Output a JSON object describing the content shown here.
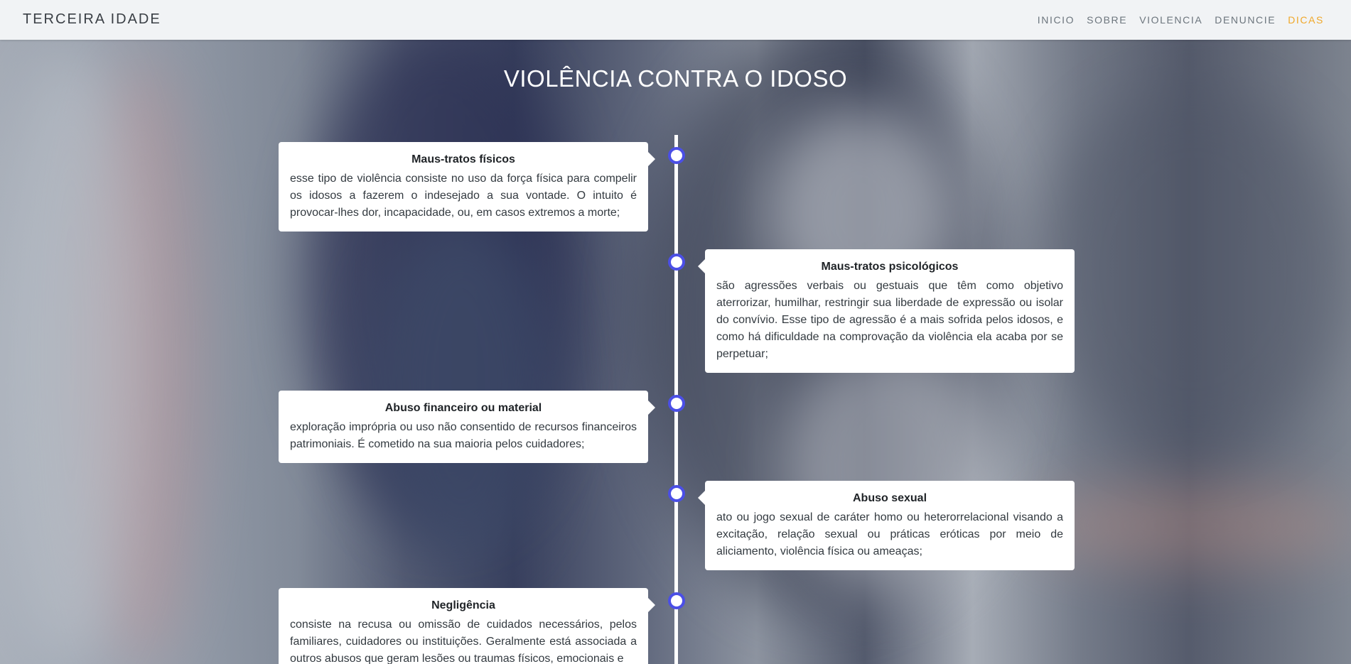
{
  "header": {
    "brand": "TERCEIRA IDADE",
    "nav": [
      {
        "label": "INICIO"
      },
      {
        "label": "SOBRE"
      },
      {
        "label": "VIOLENCIA"
      },
      {
        "label": "DENUNCIE"
      },
      {
        "label": "DICAS"
      }
    ],
    "active_color": "#f0a82a"
  },
  "main": {
    "title": "VIOLÊNCIA CONTRA O IDOSO",
    "timeline_dot_color": "#4b4fe6",
    "items": [
      {
        "title": "Maus-tratos físicos",
        "text": "esse tipo de violência consiste no uso da força física para compelir os idosos a fazerem o indesejado a sua vontade. O intuito é  provocar-lhes dor, incapacidade, ou, em casos extremos a morte;"
      },
      {
        "title": "Maus-tratos psicológicos",
        "text": "são agressões verbais ou gestuais que têm como objetivo aterrorizar, humilhar, restringir sua liberdade de expressão ou isolar do convívio. Esse tipo de agressão é a mais sofrida pelos idosos, e como há dificuldade na comprovação da violência ela acaba por se perpetuar;"
      },
      {
        "title": "Abuso financeiro ou material",
        "text": "exploração imprópria ou uso não consentido de recursos financeiros patrimoniais. É cometido na sua maioria pelos cuidadores;"
      },
      {
        "title": "Abuso sexual",
        "text": "ato ou jogo sexual de caráter homo ou heterorrelacional visando a excitação, relação sexual ou práticas eróticas por meio de aliciamento, violência física ou ameaças;"
      },
      {
        "title": "Negligência",
        "text": "consiste na recusa ou omissão de cuidados necessários, pelos familiares, cuidadores ou instituições. Geralmente está associada a outros abusos que geram lesões ou traumas físicos, emocionais e"
      }
    ]
  }
}
